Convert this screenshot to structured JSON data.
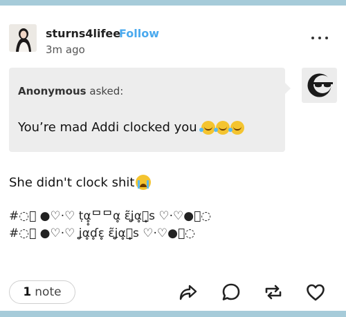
{
  "post": {
    "username": "sturns4lifee",
    "follow_label": "Follow",
    "timestamp": "3m ago"
  },
  "ask": {
    "asker": "Anonymous",
    "asked_label": "asked:",
    "question": "You’re mad Addi clocked you"
  },
  "body": {
    "reply": "She didn't clock shit"
  },
  "tags": [
    "#◌⃝ ●♡·♡ ṭα̥̥ᄆᄆα̥ ɛ̃ʝα̥ℊ̥ѕ ♡·♡●⃝◌",
    "#◌⃝ ●♡·♡ ʝα̥ɗ̥ɛ̥ ɛ̃ʝα̥ℊ̥ѕ ♡·♡●⃝◌"
  ],
  "footer": {
    "notes_count": "1",
    "notes_label": "note"
  },
  "icons": {
    "more": "ellipsis-icon",
    "share": "share-icon",
    "reply": "reply-icon",
    "reblog": "reblog-icon",
    "like": "heart-icon"
  },
  "colors": {
    "accent": "#4aa9ee",
    "background": "#a6cbd9",
    "ask_bg": "#ededed"
  }
}
